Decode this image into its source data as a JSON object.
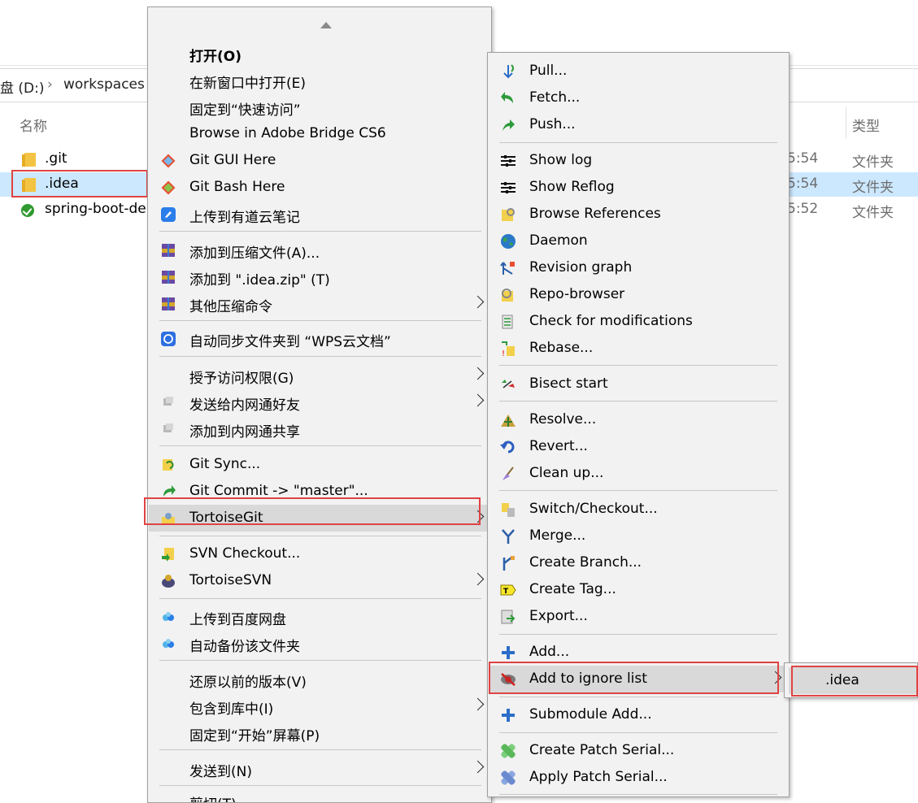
{
  "breadcrumb": {
    "drive": "盘 (D:)",
    "sep": "›",
    "folder": "workspaces"
  },
  "columns": {
    "name": "名称",
    "type": "类型"
  },
  "files": [
    {
      "name": ".git",
      "date": "5:54",
      "type": "文件夹"
    },
    {
      "name": ".idea",
      "date": "5:54",
      "type": "文件夹"
    },
    {
      "name": "spring-boot-de",
      "date": "5:52",
      "type": "文件夹"
    }
  ],
  "context_menu": {
    "items": [
      {
        "label": "打开(O)"
      },
      {
        "label": "在新窗口中打开(E)"
      },
      {
        "label": "固定到“快速访问”"
      },
      {
        "label": "Browse in Adobe Bridge CS6"
      },
      {
        "label": "Git GUI Here"
      },
      {
        "label": "Git Bash Here"
      },
      {
        "label": "上传到有道云笔记"
      },
      {
        "label": "添加到压缩文件(A)..."
      },
      {
        "label": "添加到 \".idea.zip\" (T)"
      },
      {
        "label": "其他压缩命令"
      },
      {
        "label": "自动同步文件夹到 “WPS云文档”"
      },
      {
        "label": "授予访问权限(G)"
      },
      {
        "label": "发送给内网通好友"
      },
      {
        "label": "添加到内网通共享"
      },
      {
        "label": "Git Sync..."
      },
      {
        "label": "Git Commit -> \"master\"..."
      },
      {
        "label": "TortoiseGit"
      },
      {
        "label": "SVN Checkout..."
      },
      {
        "label": "TortoiseSVN"
      },
      {
        "label": "上传到百度网盘"
      },
      {
        "label": "自动备份该文件夹"
      },
      {
        "label": "还原以前的版本(V)"
      },
      {
        "label": "包含到库中(I)"
      },
      {
        "label": "固定到“开始”屏幕(P)"
      },
      {
        "label": "发送到(N)"
      },
      {
        "label": "剪切(T)"
      }
    ]
  },
  "tortoisegit_menu": {
    "items": [
      {
        "label": "Pull..."
      },
      {
        "label": "Fetch..."
      },
      {
        "label": "Push..."
      },
      {
        "label": "Show log"
      },
      {
        "label": "Show Reflog"
      },
      {
        "label": "Browse References"
      },
      {
        "label": "Daemon"
      },
      {
        "label": "Revision graph"
      },
      {
        "label": "Repo-browser"
      },
      {
        "label": "Check for modifications"
      },
      {
        "label": "Rebase..."
      },
      {
        "label": "Bisect start"
      },
      {
        "label": "Resolve..."
      },
      {
        "label": "Revert..."
      },
      {
        "label": "Clean up..."
      },
      {
        "label": "Switch/Checkout..."
      },
      {
        "label": "Merge..."
      },
      {
        "label": "Create Branch..."
      },
      {
        "label": "Create Tag..."
      },
      {
        "label": "Export..."
      },
      {
        "label": "Add..."
      },
      {
        "label": "Add to ignore list"
      },
      {
        "label": "Submodule Add..."
      },
      {
        "label": "Create Patch Serial..."
      },
      {
        "label": "Apply Patch Serial..."
      }
    ]
  },
  "ignore_submenu": {
    "items": [
      {
        "label": ".idea"
      }
    ]
  },
  "colors": {
    "highlight_box": "#e04343",
    "selection": "#cce8ff",
    "menu_bg": "#f2f2f2"
  }
}
